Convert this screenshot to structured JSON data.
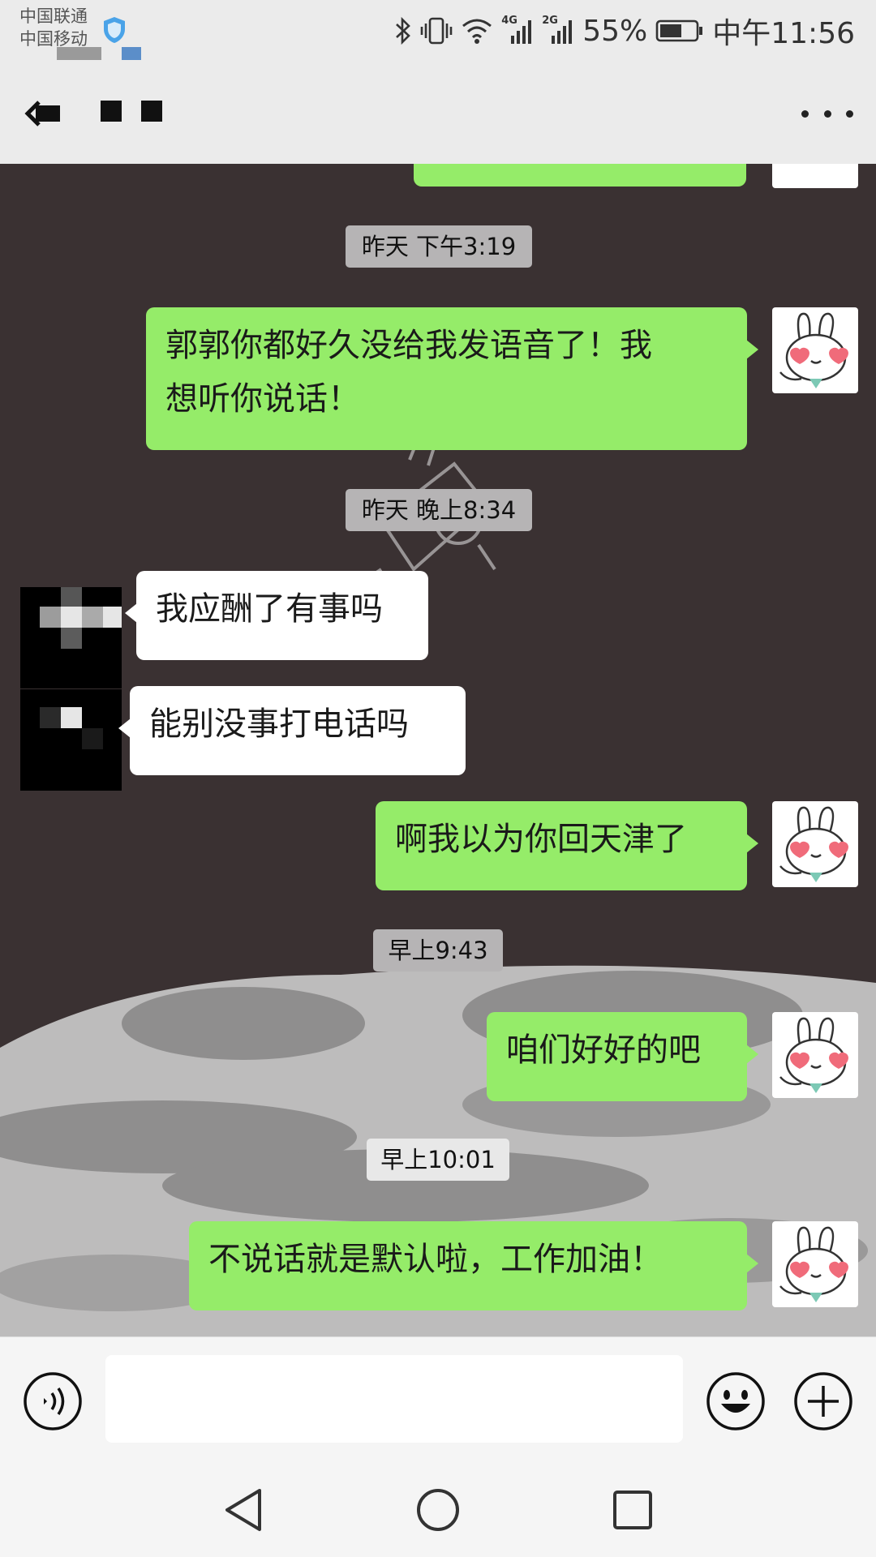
{
  "status_bar": {
    "carrier_1": "中国联通",
    "carrier_2": "中国移动",
    "signal_1_label": "4G",
    "signal_2_label": "2G",
    "battery_percent": "55%",
    "clock": "中午11:56"
  },
  "colors": {
    "my_bubble": "#95ec69",
    "other_bubble": "#ffffff",
    "chat_background": "#3a3132",
    "header": "#ebebeb"
  },
  "messages": [
    {
      "type": "time",
      "text": "昨天 下午3:19"
    },
    {
      "type": "sent",
      "text_line1": "郭郭你都好久没给我发语音了！我",
      "text_line2": "想听你说话！"
    },
    {
      "type": "time",
      "text": "昨天 晚上8:34"
    },
    {
      "type": "received",
      "text": "我应酬了有事吗"
    },
    {
      "type": "received",
      "text": "能别没事打电话吗"
    },
    {
      "type": "sent",
      "text": "啊我以为你回天津了"
    },
    {
      "type": "time",
      "text": "早上9:43"
    },
    {
      "type": "sent",
      "text": "咱们好好的吧"
    },
    {
      "type": "time",
      "text": "早上10:01"
    },
    {
      "type": "sent",
      "text": "不说话就是默认啦，工作加油！"
    }
  ],
  "input_bar": {
    "voice_icon": "voice-icon",
    "emoji_icon": "emoji-icon",
    "plus_icon": "plus-icon",
    "text_value": ""
  },
  "nav_bar": {
    "back_icon": "triangle-back-icon",
    "home_icon": "circle-home-icon",
    "recents_icon": "square-recents-icon"
  }
}
